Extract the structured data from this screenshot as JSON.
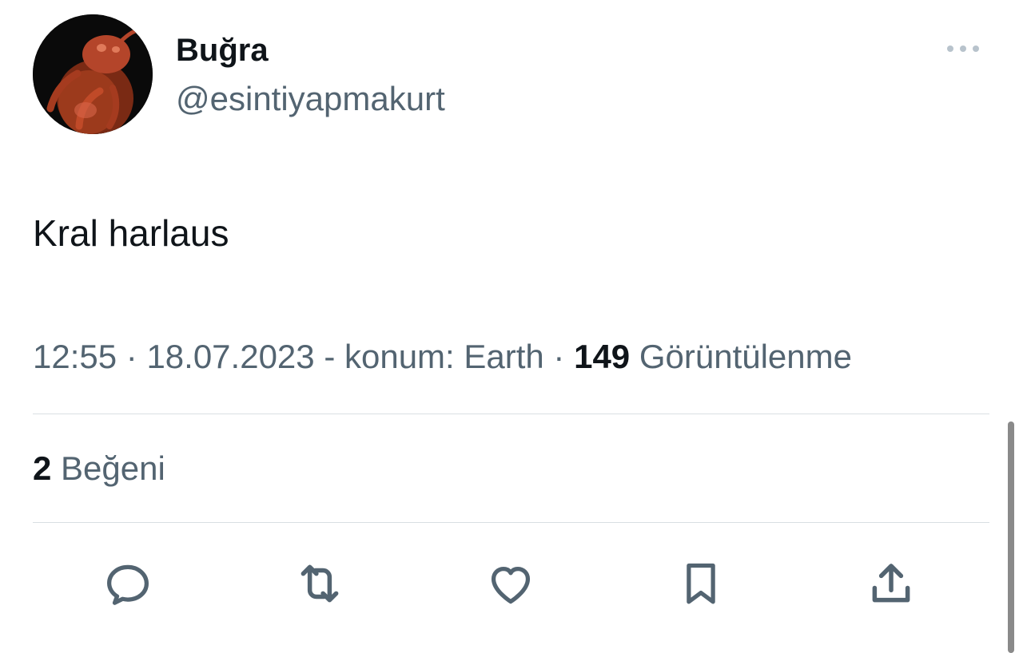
{
  "author": {
    "display_name": "Buğra",
    "handle": "@esintiyapmakurt",
    "avatar_icon": "bug-avatar"
  },
  "tweet": {
    "text": "Kral harlaus"
  },
  "meta": {
    "time": "12:55",
    "sep1": " · ",
    "date": "18.07.2023",
    "location_text": " - konum: Earth",
    "sep2": " · ",
    "views_count": "149",
    "views_label": " Görüntülenme"
  },
  "stats": {
    "likes_count": "2",
    "likes_label": " Beğeni"
  },
  "actions": {
    "reply_icon": "reply-icon",
    "retweet_icon": "retweet-icon",
    "like_icon": "heart-icon",
    "bookmark_icon": "bookmark-icon",
    "share_icon": "share-icon",
    "more_icon": "more-options-icon"
  },
  "colors": {
    "text_primary": "#0f1419",
    "text_secondary": "#536471",
    "divider": "#d9dfe3",
    "icon": "#536471"
  }
}
